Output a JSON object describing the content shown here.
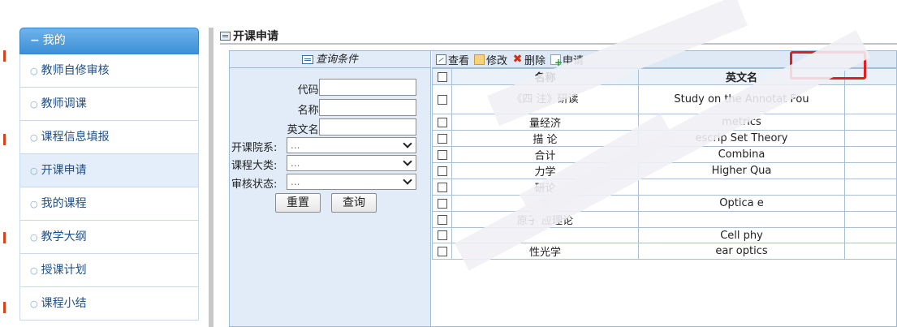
{
  "nav": {
    "header": "我的",
    "items": [
      {
        "label": "教师自修审核"
      },
      {
        "label": "教师调课"
      },
      {
        "label": "课程信息填报"
      },
      {
        "label": "开课申请",
        "active": true
      },
      {
        "label": "我的课程"
      },
      {
        "label": "教学大纲"
      },
      {
        "label": "授课计划"
      },
      {
        "label": "课程小结"
      }
    ]
  },
  "page": {
    "title": "开课申请"
  },
  "query": {
    "title": "查询条件",
    "code_label": "代码:",
    "name_label": "名称:",
    "en_name_label": "英文名:",
    "dept_label": "开课院系:",
    "category_label": "课程大类:",
    "status_label": "审核状态:",
    "select_placeholder": "...",
    "reset_label": "重置",
    "search_label": "查询"
  },
  "toolbar": {
    "view_label": "查看",
    "edit_label": "修改",
    "delete_label": "删除",
    "apply_label": "申请"
  },
  "table": {
    "headers": {
      "name": "名称",
      "en_name": "英文名"
    },
    "rows": [
      {
        "name": "《四 注》研读",
        "en_name": "Study on the Annotat Fou"
      },
      {
        "name": "量经济",
        "en_name": "metrics"
      },
      {
        "name": "描 论",
        "en_name": "escrip  Set Theory"
      },
      {
        "name": "合计",
        "en_name": "Combina"
      },
      {
        "name": "力学",
        "en_name": "Higher Qua"
      },
      {
        "name": "研论",
        "en_name": ""
      },
      {
        "name": "学",
        "en_name": "Optica  e"
      },
      {
        "name": "原子 应理论",
        "en_name": ""
      },
      {
        "name": "",
        "en_name": "Cell  phy"
      },
      {
        "name": "性光学",
        "en_name": "ear optics"
      }
    ]
  },
  "colors": {
    "nav_header": "#3d8fd6",
    "highlight_border": "#e02020",
    "query_bg": "#e1ecf8"
  }
}
